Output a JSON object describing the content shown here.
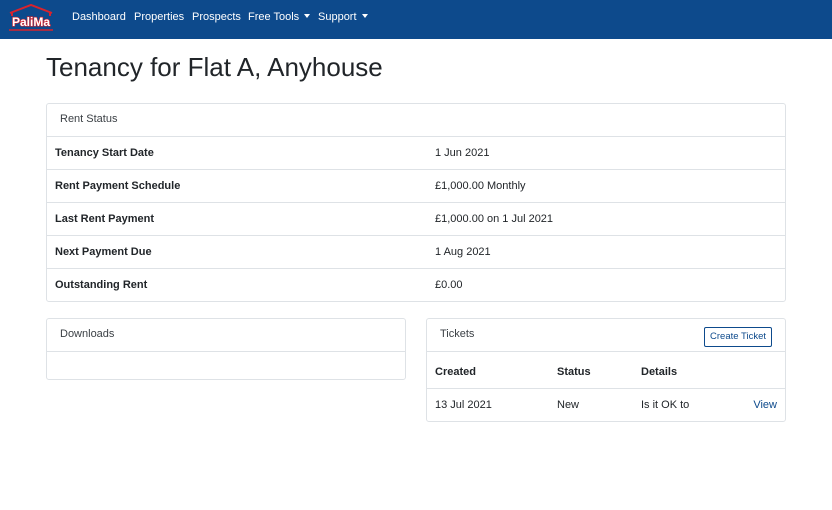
{
  "nav": {
    "logo_text": "PaliMa",
    "items": [
      {
        "label": "Dashboard"
      },
      {
        "label": "Properties"
      },
      {
        "label": "Prospects"
      },
      {
        "label": "Free Tools"
      },
      {
        "label": "Support"
      }
    ]
  },
  "page": {
    "title": "Tenancy for Flat A, Anyhouse"
  },
  "rent_status": {
    "header": "Rent Status",
    "rows": [
      {
        "label": "Tenancy Start Date",
        "value": "1 Jun 2021"
      },
      {
        "label": "Rent Payment Schedule",
        "value": "£1,000.00 Monthly"
      },
      {
        "label": "Last Rent Payment",
        "value": "£1,000.00 on 1 Jul 2021"
      },
      {
        "label": "Next Payment Due",
        "value": "1 Aug 2021"
      },
      {
        "label": "Outstanding Rent",
        "value": "£0.00"
      }
    ]
  },
  "downloads": {
    "header": "Downloads"
  },
  "tickets": {
    "header": "Tickets",
    "create_button": "Create Ticket",
    "columns": [
      "Created",
      "Status",
      "Details"
    ],
    "rows": [
      {
        "created": "13 Jul 2021",
        "status": "New",
        "details": "Is it OK to",
        "action": "View"
      }
    ]
  },
  "colors": {
    "navbar": "#0d4a8c",
    "logo_red": "#d9232d",
    "link": "#0d4a8c"
  }
}
